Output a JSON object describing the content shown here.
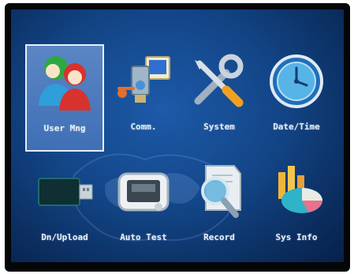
{
  "menu": {
    "items": [
      {
        "label": "User Mng",
        "icon": "users-icon",
        "selected": true
      },
      {
        "label": "Comm.",
        "icon": "network-icon",
        "selected": false
      },
      {
        "label": "System",
        "icon": "tools-icon",
        "selected": false
      },
      {
        "label": "Date/Time",
        "icon": "clock-icon",
        "selected": false
      },
      {
        "label": "Dn/Upload",
        "icon": "usb-drive-icon",
        "selected": false
      },
      {
        "label": "Auto Test",
        "icon": "device-test-icon",
        "selected": false
      },
      {
        "label": "Record",
        "icon": "search-record-icon",
        "selected": false
      },
      {
        "label": "Sys Info",
        "icon": "pie-chart-icon",
        "selected": false
      }
    ]
  },
  "colors": {
    "screen_bg": "#134688",
    "selection": "#3f6fb5",
    "label_text": "#e6eef9"
  }
}
